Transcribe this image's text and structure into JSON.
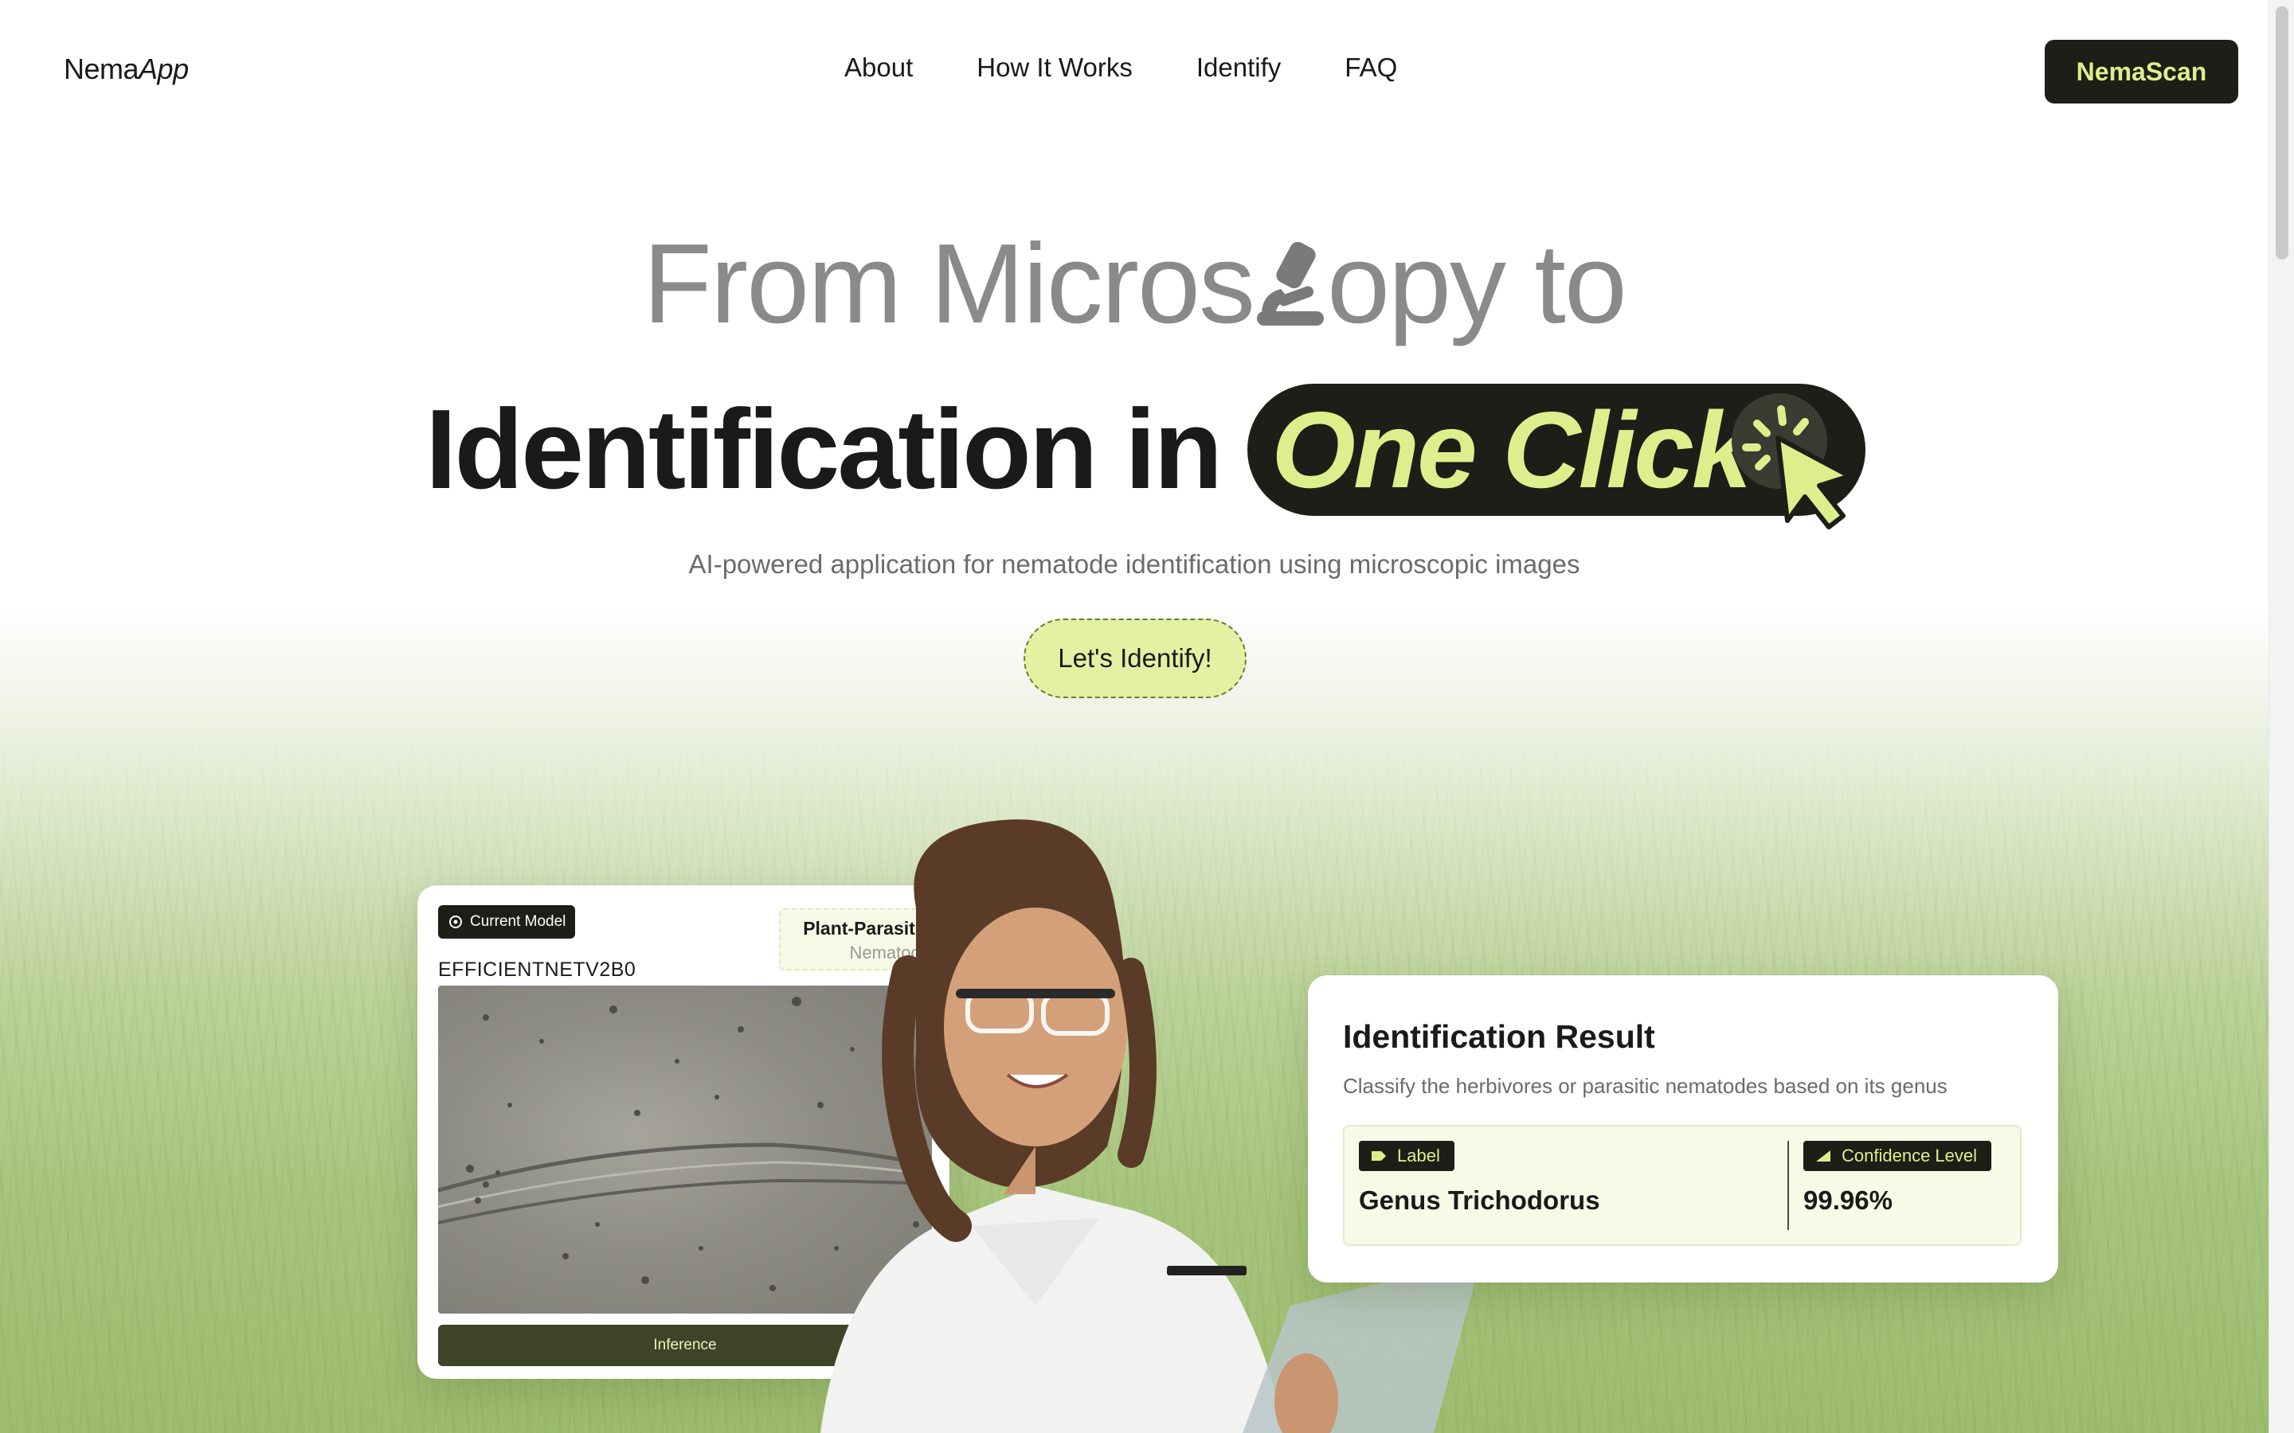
{
  "brand": {
    "logo_main": "Nema",
    "logo_italic": "App"
  },
  "nav": {
    "links": [
      "About",
      "How It Works",
      "Identify",
      "FAQ"
    ],
    "cta": "NemaScan"
  },
  "hero": {
    "line1_a": "From Micros",
    "line1_b": "opy to",
    "line2": "Identification in",
    "pill": "One Click",
    "subtitle": "AI-powered application for nematode identification using microscopic images",
    "cta": "Let's Identify!"
  },
  "model_card": {
    "badge": "Current Model",
    "model_name": "EFFICIENTNETV2B0",
    "type_main": "Plant-Parasitic",
    "type_sub": "Nematode",
    "inference_label": "Inference"
  },
  "result_card": {
    "title": "Identification Result",
    "description": "Classify the herbivores or parasitic nematodes based on its genus",
    "label_chip": "Label",
    "label_value": "Genus Trichodorus",
    "confidence_chip": "Confidence Level",
    "confidence_value": "99.96%"
  },
  "colors": {
    "dark": "#1d1e17",
    "accent_lime": "#dcef8c",
    "hero_button_bg": "#e3f1a3",
    "grass_green": "#a7c47c"
  },
  "icons": [
    "microscope-icon",
    "cursor-click-icon",
    "model-icon",
    "tag-icon",
    "signal-icon"
  ]
}
